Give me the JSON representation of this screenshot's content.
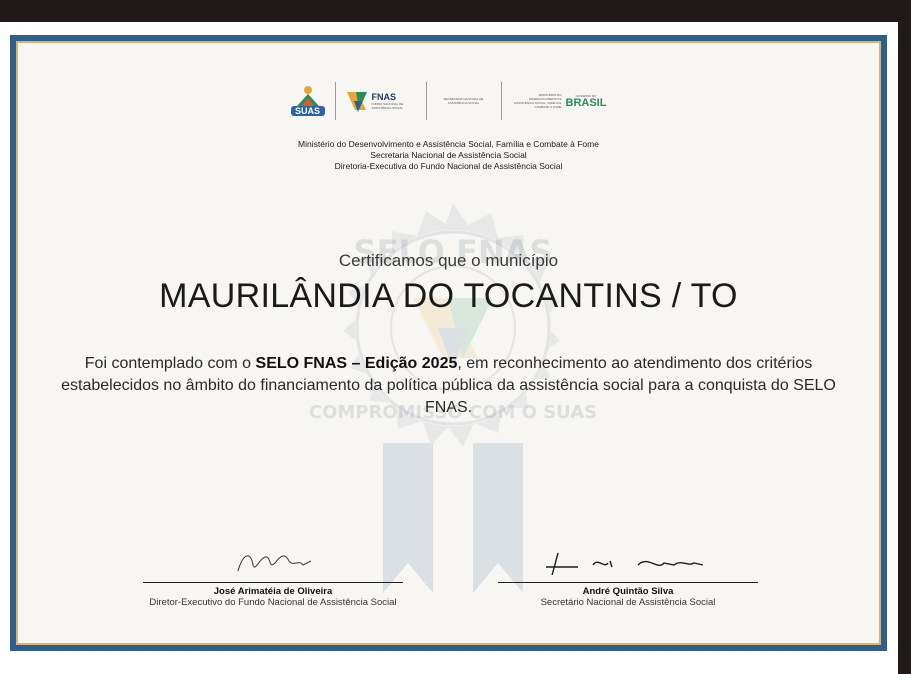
{
  "logos": {
    "suas_label": "SUAS",
    "fnas_label": "FNAS",
    "fnas_sub": "FUNDO NACIONAL DE ASSISTÊNCIA SOCIAL",
    "snas_text": "SECRETARIA NACIONAL DE ASSISTÊNCIA SOCIAL",
    "ministry_text": "MINISTÉRIO DO DESENVOLVIMENTO E ASSISTÊNCIA SOCIAL, FAMÍLIA E COMBATE À FOME",
    "gov_small": "GOVERNO DO",
    "gov_brasil": "BRASIL"
  },
  "header": {
    "line1": "Ministério do Desenvolvimento e Assistência Social, Família e Combate à Fome",
    "line2": "Secretaria Nacional de Assistência Social",
    "line3": "Diretoria-Executiva do Fundo Nacional de Assistência Social"
  },
  "certificate": {
    "intro": "Certificamos que o município",
    "municipality": "MAURILÂNDIA DO TOCANTINS / TO",
    "body_pre": "Foi contemplado com o ",
    "body_bold": "SELO FNAS – Edição 2025",
    "body_post": ", em reconhecimento ao atendimento dos critérios estabelecidos no âmbito do financiamento da política pública da assistência social para a conquista do SELO FNAS."
  },
  "watermark": {
    "top_text": "SELO FNAS",
    "bottom_text": "COMPROMISSO COM O SUAS"
  },
  "signatures": {
    "left_name": "José Arimatéia de Oliveira",
    "left_role": "Diretor-Executivo do Fundo Nacional de Assistência Social",
    "right_name": "André Quintão Silva",
    "right_role": "Secretário Nacional de Assistência Social"
  },
  "colors": {
    "frame": "#2f5f8a",
    "gold": "#d8b56b",
    "paper": "#f7f6f3"
  }
}
